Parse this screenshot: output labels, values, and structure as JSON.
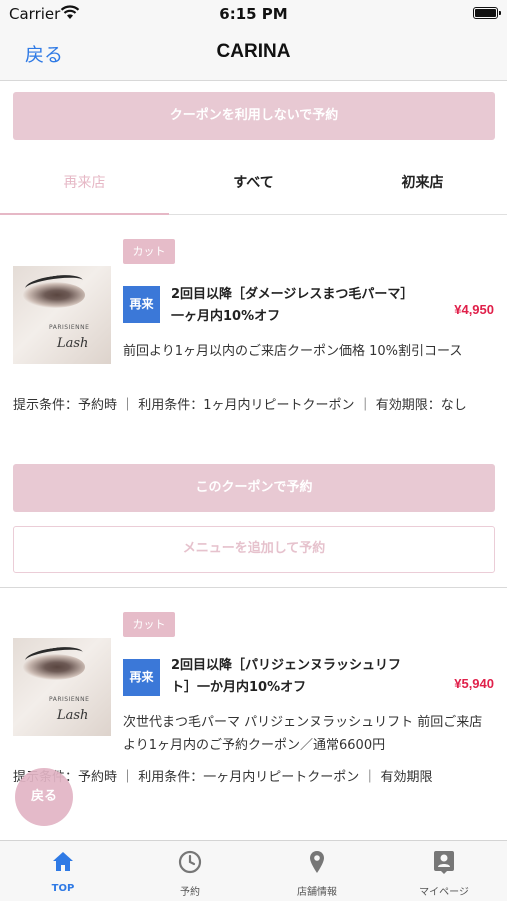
{
  "status_bar": {
    "carrier": "Carrier",
    "time": "6:15 PM"
  },
  "nav": {
    "back": "戻る",
    "title": "CARINA"
  },
  "top_button": "クーポンを利用しないで予約",
  "tabs": [
    {
      "label": "再来店",
      "active": true
    },
    {
      "label": "すべて",
      "active": false
    },
    {
      "label": "初来店",
      "active": false
    }
  ],
  "coupons": [
    {
      "category": "カット",
      "badge": "再来",
      "title": "2回目以降［ダメージレスまつ毛パーマ］一ヶ月内10%オフ",
      "price": "¥4,950",
      "description": "前回より1ヶ月以内のご来店クーポン価格 10%割引コース",
      "conditions": "提示条件：予約時 ｜ 利用条件：1ヶ月内リピートクーポン ｜ 有効期限：なし",
      "reserve_button": "このクーポンで予約",
      "add_menu_button": "メニューを追加して予約",
      "image_brand": "PARISIENNE"
    },
    {
      "category": "カット",
      "badge": "再来",
      "title": "2回目以降［パリジェンヌラッシュリフト］一か月内10%オフ",
      "price": "¥5,940",
      "description": "次世代まつ毛パーマ パリジェンヌラッシュリフト 前回ご来店より1ヶ月内のご予約クーポン／通常6600円",
      "conditions": "提示条件：予約時 ｜ 利用条件：一ヶ月内リピートクーポン ｜ 有効期限",
      "image_brand": "PARISIENNE"
    }
  ],
  "floating_back": "戻る",
  "tab_bar": [
    {
      "label": "TOP",
      "icon": "home-icon",
      "active": true
    },
    {
      "label": "予約",
      "icon": "clock-icon",
      "active": false
    },
    {
      "label": "店舗情報",
      "icon": "location-pin-icon",
      "active": false
    },
    {
      "label": "マイページ",
      "icon": "user-card-icon",
      "active": false
    }
  ],
  "colors": {
    "accent_pink": "#e8c9d3",
    "blue": "#2f7ae5",
    "price_red": "#e0204a",
    "badge_blue": "#3b78d8"
  }
}
